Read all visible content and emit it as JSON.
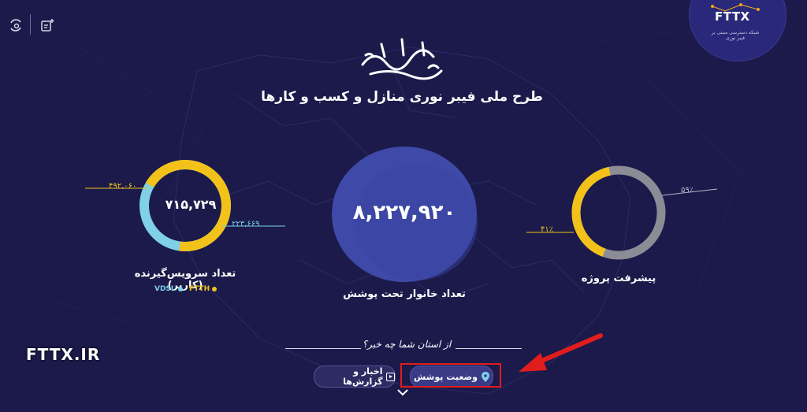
{
  "toolbar": {
    "settings_icon": "settings-cycle-icon",
    "add_icon": "add-note-icon"
  },
  "brand": {
    "logo_text": "FTTX",
    "logo_subtitle": "شبکه دسترسی مبتنی بر فیبر نوری",
    "calligraphy": "طعم شیرین فناوری",
    "main_title": "طرح ملی فیبر نوری منازل و کسب و کارها"
  },
  "center_stat": {
    "value": "۸,۲۲۷,۹۲۰",
    "label": "تعداد خانوار تحت پوشش"
  },
  "users_chart": {
    "center_value": "۷۱۵,۷۲۹",
    "label": "تعداد سرویس‌گیرنده (کاربر)",
    "ftth_value": "۴۹۲,۰۶۰",
    "vdsl_value": "۲۲۳,۶۶۹",
    "ftth_fraction": 0.6875,
    "legend_ftth": "FTTH",
    "legend_vdsl": "VDSL"
  },
  "progress_chart": {
    "label": "پیشرفت پروژه",
    "done_text": "۴۱٪",
    "remaining_text": "۵۹٪",
    "done_fraction": 0.41
  },
  "nav": {
    "question": "از استان شما چه خبر؟",
    "coverage_button": "وضعیت پوشش",
    "news_button": "اخبار و گزارش‌ها"
  },
  "watermark": "FTTX.IR",
  "colors": {
    "background": "#1b1a4a",
    "yellow": "#f2c21b",
    "light_blue": "#7fd0e8",
    "gray": "#8c8c96",
    "circle": "#3f49a8",
    "highlight": "#e11c1c"
  }
}
